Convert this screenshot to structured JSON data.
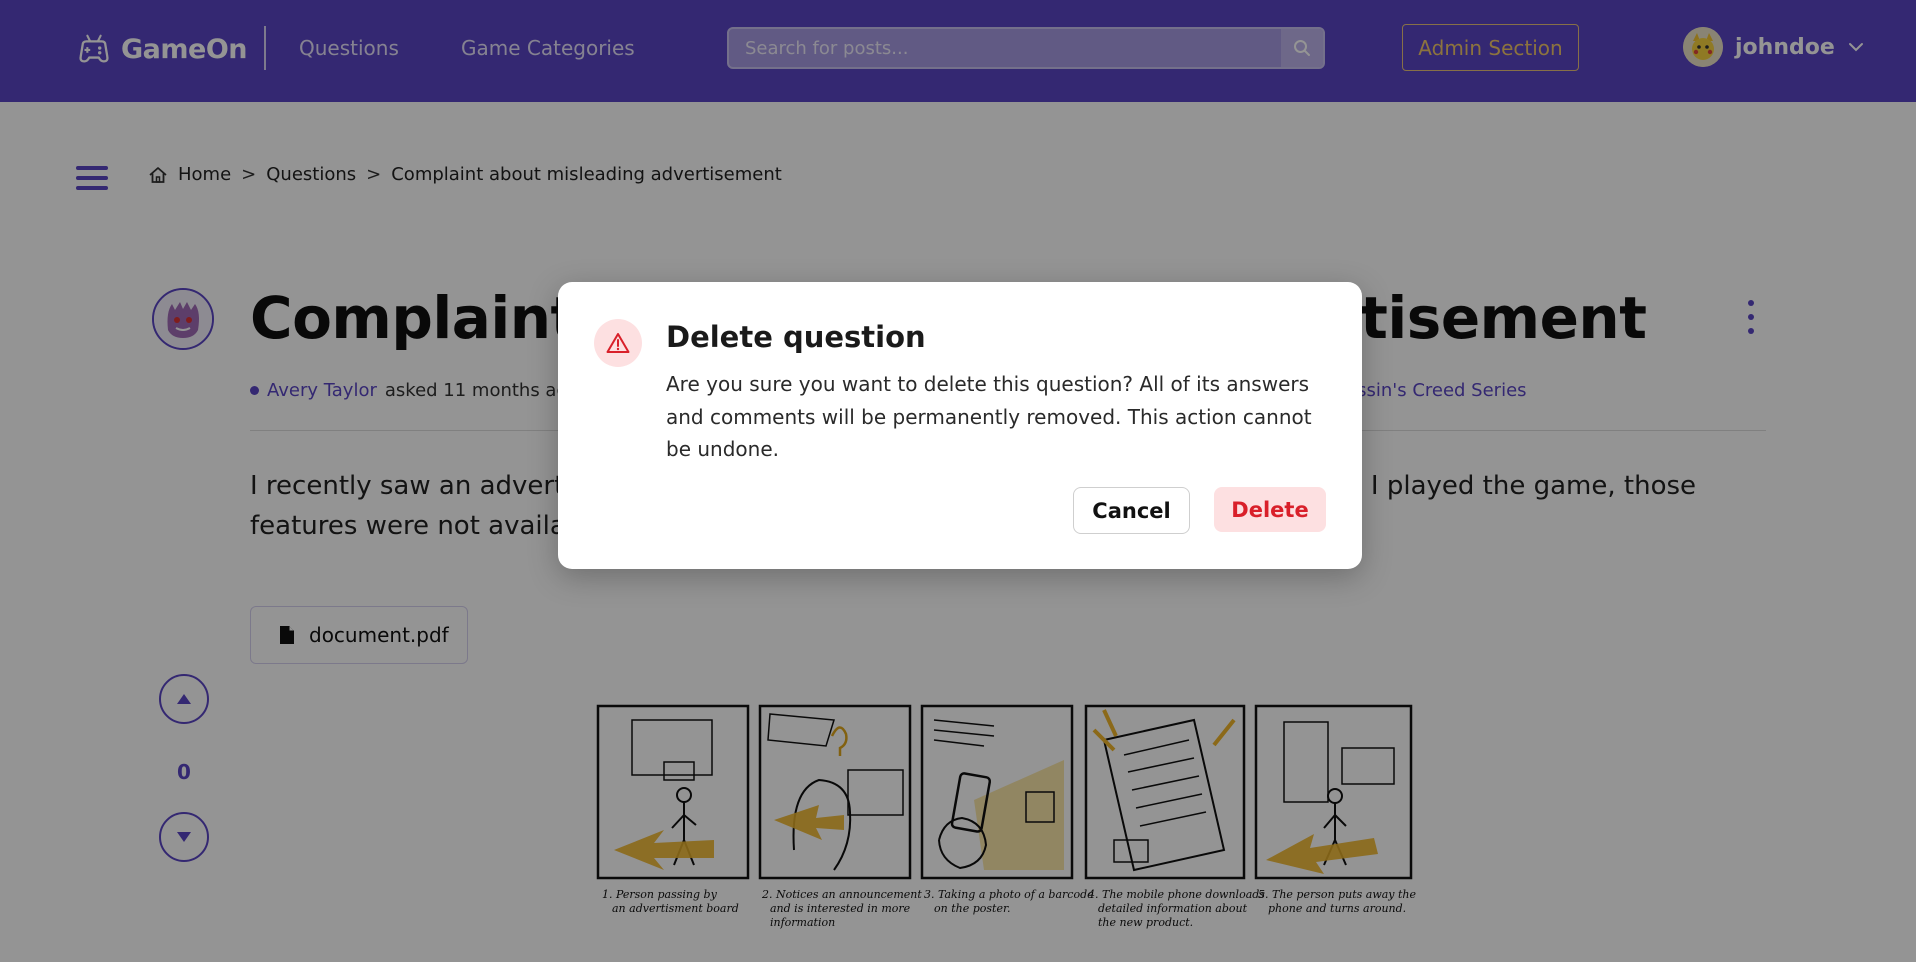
{
  "header": {
    "brand": "GameOn",
    "nav": [
      "Questions",
      "Game Categories"
    ],
    "search_placeholder": "Search for posts...",
    "admin_label": "Admin Section",
    "username": "johndoe",
    "colors": {
      "primary": "#5b45c4",
      "admin_accent": "#f1c66c"
    },
    "icons": {
      "logo": "gamepad-icon",
      "search": "search-icon",
      "user_menu": "chevron-down-icon"
    }
  },
  "breadcrumb": {
    "items": [
      "Home",
      "Questions",
      "Complaint about misleading advertisement"
    ],
    "separator": ">",
    "icons": {
      "home": "home-icon",
      "menu": "hamburger-icon"
    }
  },
  "question": {
    "title": "Complaint about misleading advertisement",
    "author": "Avery Taylor",
    "asked_text": "asked 11 months ago",
    "tag": "Assassin's Creed Series",
    "body": "I recently saw an advertisement for a game that promised certain features, but when I played the game, those features were not available. This is misleading!",
    "attachment_name": "document.pdf",
    "vote_count": "0",
    "icons": {
      "more": "kebab-menu-icon",
      "attachment": "file-icon",
      "upvote": "triangle-up-icon",
      "downvote": "triangle-down-icon"
    }
  },
  "comic_captions": [
    "1. Person passing by an advertisment board",
    "2. Notices an announcement and is interested in more information",
    "3. Taking a photo of a barcode on the poster.",
    "4. The mobile phone downloads detailed information about the new product.",
    "5. The person puts away the phone and turns around."
  ],
  "modal": {
    "title": "Delete question",
    "message": "Are you sure you want to delete this question? All of its answers and comments will be permanently removed. This action cannot be undone.",
    "cancel_label": "Cancel",
    "delete_label": "Delete",
    "colors": {
      "danger": "#d9202a",
      "danger_bg": "#fde0e1"
    },
    "icon": "warning-triangle-icon"
  }
}
